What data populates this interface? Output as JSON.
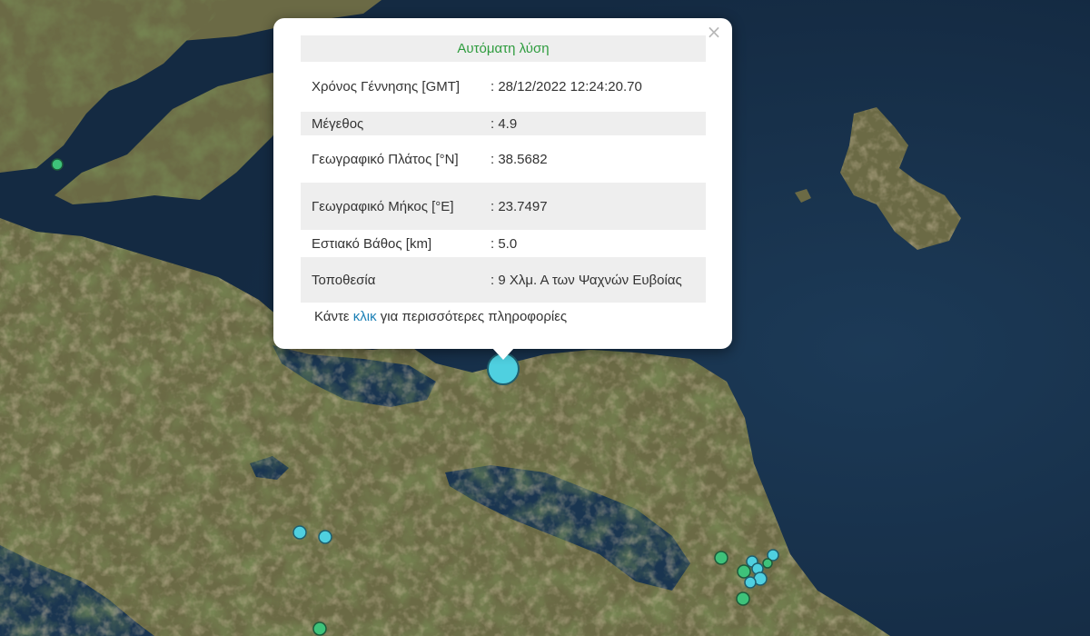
{
  "map": {
    "colors": {
      "sea": "#17304a",
      "land": "#6b6a45",
      "land_dark": "#4f5a34",
      "land_light": "#8f7f58",
      "marker_cyan": "#4fd0e0",
      "marker_green": "#3ec27a"
    },
    "highlighted_event": {
      "type": "earthquake",
      "magnitude": 4.9,
      "color": "#4fd0e0"
    },
    "other_events": [
      {
        "id": "ev-1",
        "color": "#3ec27a"
      },
      {
        "id": "ev-2",
        "color": "#4fd0e0"
      },
      {
        "id": "ev-3",
        "color": "#4fd0e0"
      },
      {
        "id": "ev-4",
        "color": "#3ec27a"
      },
      {
        "id": "ev-5",
        "color": "#3ec27a"
      },
      {
        "id": "ev-6",
        "color": "#4fd0e0"
      },
      {
        "id": "ev-7",
        "color": "#4fd0e0"
      },
      {
        "id": "ev-8",
        "color": "#4fd0e0"
      },
      {
        "id": "ev-9",
        "color": "#3ec27a"
      },
      {
        "id": "ev-10",
        "color": "#4fd0e0"
      },
      {
        "id": "ev-11",
        "color": "#4fd0e0"
      },
      {
        "id": "ev-12",
        "color": "#3ec27a"
      },
      {
        "id": "ev-13",
        "color": "#3ec27a"
      }
    ]
  },
  "popup": {
    "title": "Αυτόματη λύση",
    "close_icon": "close-icon",
    "rows": [
      {
        "label": "Χρόνος Γέννησης [GMT]",
        "value": ": 28/12/2022 12:24:20.70"
      },
      {
        "label": "Μέγεθος",
        "value": ": 4.9"
      },
      {
        "label": "Γεωγραφικό Πλάτος [°N]",
        "value": ": 38.5682"
      },
      {
        "label": "Γεωγραφικό Μήκος [°E]",
        "value": ": 23.7497"
      },
      {
        "label": "Εστιακό Βάθος [km]",
        "value": ": 5.0"
      },
      {
        "label": "Τοποθεσία",
        "value": ": 9 Χλμ. Α των Ψαχνών Ευβοίας"
      }
    ],
    "more_prefix": "Κάντε ",
    "more_link": "κλικ",
    "more_suffix": " για περισσότερες πληροφορίες"
  }
}
